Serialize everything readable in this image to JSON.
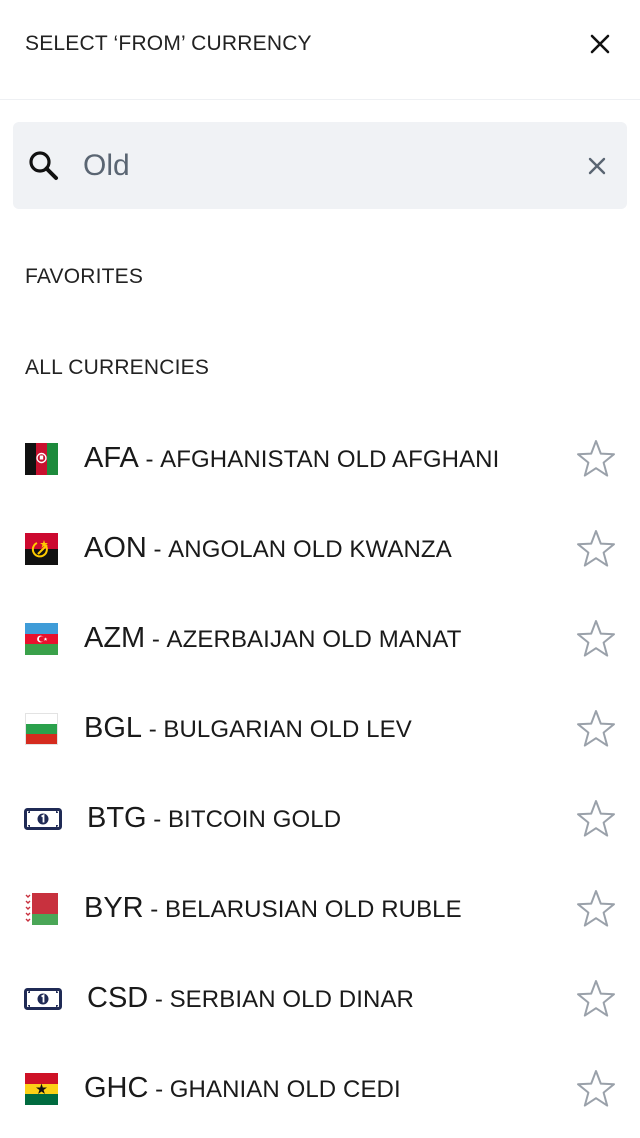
{
  "header": {
    "title": "SELECT ‘FROM’ CURRENCY"
  },
  "search": {
    "value": "Old"
  },
  "sections": {
    "favorites": "FAVORITES",
    "all": "ALL CURRENCIES"
  },
  "separator": " - ",
  "currencies": [
    {
      "code": "AFA",
      "name": "AFGHANISTAN OLD AFGHANI",
      "icon": "afghanistan-flag-icon"
    },
    {
      "code": "AON",
      "name": "ANGOLAN OLD KWANZA",
      "icon": "angola-flag-icon"
    },
    {
      "code": "AZM",
      "name": "AZERBAIJAN OLD MANAT",
      "icon": "azerbaijan-flag-icon"
    },
    {
      "code": "BGL",
      "name": "BULGARIAN OLD LEV",
      "icon": "bulgaria-flag-icon"
    },
    {
      "code": "BTG",
      "name": "BITCOIN GOLD",
      "icon": "banknote-icon"
    },
    {
      "code": "BYR",
      "name": "BELARUSIAN OLD RUBLE",
      "icon": "belarus-flag-icon"
    },
    {
      "code": "CSD",
      "name": "SERBIAN OLD DINAR",
      "icon": "banknote-icon"
    },
    {
      "code": "GHC",
      "name": "GHANIAN OLD CEDI",
      "icon": "ghana-flag-icon"
    }
  ],
  "colors": {
    "search_bg": "#f0f2f5",
    "star_outline": "#9aa1aa",
    "divider": "#eef0f3"
  }
}
